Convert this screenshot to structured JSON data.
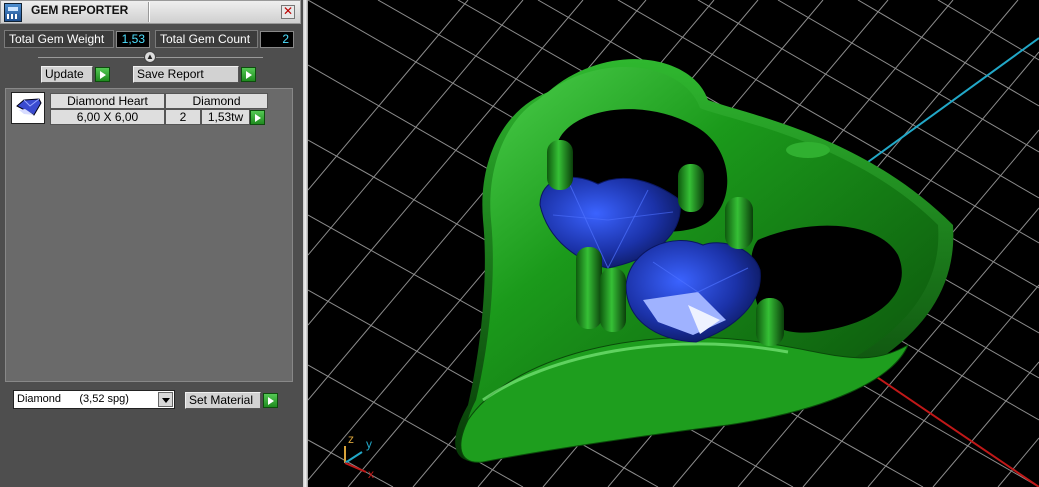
{
  "window": {
    "title": "GEM REPORTER"
  },
  "stats": {
    "total_weight_label": "Total Gem Weight",
    "total_weight_value": "1,53",
    "total_count_label": "Total Gem Count",
    "total_count_value": "2"
  },
  "buttons": {
    "update": "Update",
    "save_report": "Save Report",
    "set_material": "Set Material"
  },
  "gem_list": {
    "rows": [
      {
        "shape": "Diamond Heart",
        "material": "Diamond",
        "size": "6,00 X 6,00",
        "count": "2",
        "weight": "1,53tw"
      }
    ]
  },
  "material_select": {
    "value": "Diamond      (3,52 spg)"
  },
  "viewport": {
    "axis_labels": {
      "z": "z",
      "y": "y",
      "x": "x"
    },
    "colors": {
      "grid": "#9a9a9a",
      "metal": "#1a8c1a",
      "gem": "#1f3fb8",
      "axis_x": "#c01818",
      "axis_y": "#22a8c8",
      "axis_z": "#d8a23a"
    }
  }
}
